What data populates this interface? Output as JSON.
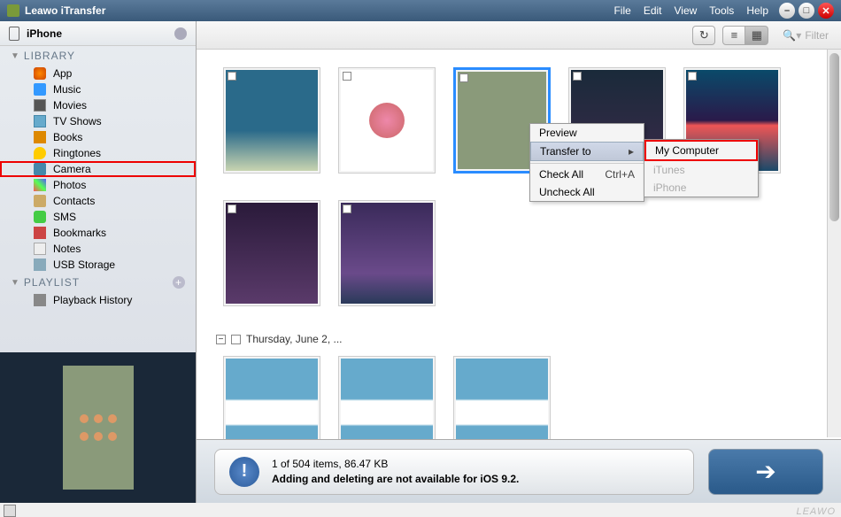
{
  "app": {
    "title": "Leawo iTransfer"
  },
  "menubar": [
    "File",
    "Edit",
    "View",
    "Tools",
    "Help"
  ],
  "device": {
    "name": "iPhone"
  },
  "sections": {
    "library": "LIBRARY",
    "playlist": "PLAYLIST"
  },
  "library_items": [
    {
      "label": "App",
      "icon": "app"
    },
    {
      "label": "Music",
      "icon": "music"
    },
    {
      "label": "Movies",
      "icon": "movies"
    },
    {
      "label": "TV Shows",
      "icon": "tv"
    },
    {
      "label": "Books",
      "icon": "books"
    },
    {
      "label": "Ringtones",
      "icon": "ring"
    },
    {
      "label": "Camera",
      "icon": "camera",
      "selected": true
    },
    {
      "label": "Photos",
      "icon": "photos"
    },
    {
      "label": "Contacts",
      "icon": "contacts"
    },
    {
      "label": "SMS",
      "icon": "sms"
    },
    {
      "label": "Bookmarks",
      "icon": "bookmarks"
    },
    {
      "label": "Notes",
      "icon": "notes"
    },
    {
      "label": "USB Storage",
      "icon": "usb"
    }
  ],
  "playlist_items": [
    {
      "label": "Playback History",
      "icon": "playback"
    }
  ],
  "toolbar": {
    "filter_placeholder": "Filter"
  },
  "date_group": "Thursday, June 2, ...",
  "context_menu": {
    "preview": "Preview",
    "transfer_to": "Transfer to",
    "check_all": "Check All",
    "check_all_shortcut": "Ctrl+A",
    "uncheck_all": "Uncheck All"
  },
  "submenu": {
    "my_computer": "My Computer",
    "itunes": "iTunes",
    "iphone": "iPhone"
  },
  "status": {
    "count_line": "1 of 504 items, 86.47 KB",
    "warning": "Adding and deleting are not available for iOS 9.2."
  },
  "brand": "LEAWO"
}
